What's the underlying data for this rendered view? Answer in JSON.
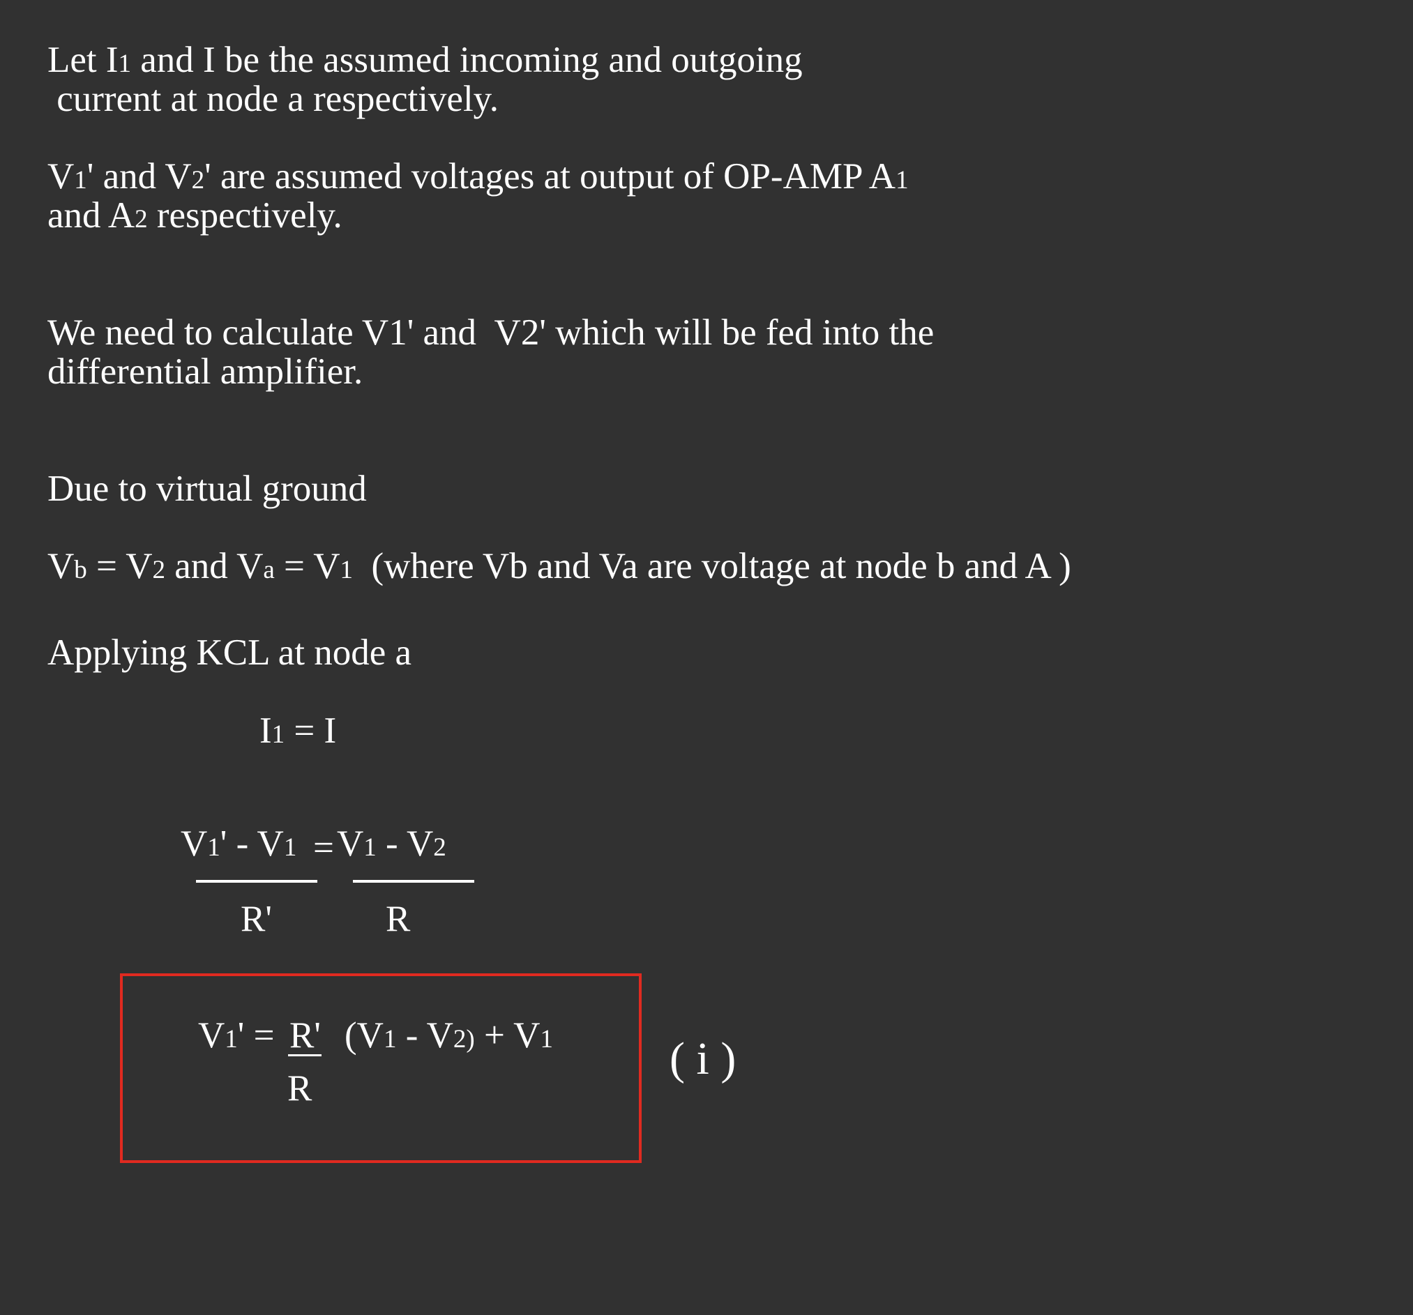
{
  "intro": {
    "line1": {
      "a": "Let I",
      "b": "1",
      "c": " and I be the assumed incoming and outgoing"
    },
    "line2": " current at node a respectively."
  },
  "assumed_voltages": {
    "line1": {
      "a": "V",
      "b": "1",
      "c": "' and V",
      "d": "2",
      "e": "' are assumed voltages at output of OP-AMP A",
      "f": "1"
    },
    "line2": {
      "a": "and A",
      "b": "2",
      "c": " respectively."
    }
  },
  "need": {
    "line1": "We need to calculate V1' and  V2' which will be fed into the",
    "line2": "differential amplifier."
  },
  "virtual_ground": {
    "heading": "Due to virtual ground",
    "eq": {
      "a": "V",
      "b": "b",
      "c": " = V",
      "d": "2",
      "e": " and V",
      "f": "a",
      "g": " = V",
      "h": "1",
      "i": "  (where Vb and Va are voltage at node b and A )"
    }
  },
  "kcl": {
    "heading": "Applying KCL at node a",
    "eq1": {
      "a": "I",
      "b": "1",
      "c": " = I"
    },
    "eq2": {
      "num_left": {
        "a": "V",
        "b": "1",
        "c": "' - V",
        "d": "1"
      },
      "equals": "=",
      "num_right": {
        "a": "V",
        "b": "1",
        "c": " - V",
        "d": "2"
      },
      "den_left": "R'",
      "den_right": "R"
    }
  },
  "result": {
    "lhs": {
      "a": "V",
      "b": "1",
      "c": "' = "
    },
    "frac_num": "R'",
    "frac_den": "R",
    "rhs": {
      "a": "(V",
      "b": "1",
      "c": " - V",
      "d": "2)",
      "e": " + V",
      "f": "1"
    },
    "label": "( i )",
    "box_color": "#e02a20"
  }
}
